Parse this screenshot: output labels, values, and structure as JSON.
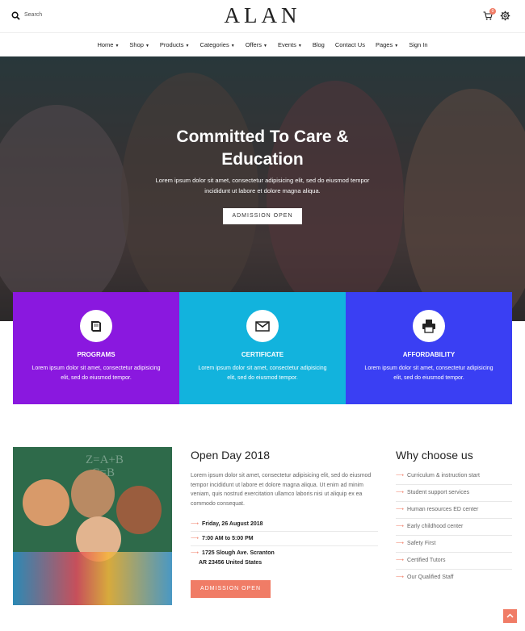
{
  "header": {
    "search_label": "Search",
    "logo": "ALAN",
    "cart_count": "0"
  },
  "nav": {
    "items": [
      {
        "label": "Home",
        "caret": "▼"
      },
      {
        "label": "Shop",
        "caret": "▼"
      },
      {
        "label": "Products",
        "caret": "▼"
      },
      {
        "label": "Categories",
        "caret": "▼"
      },
      {
        "label": "Offers",
        "caret": "▼"
      },
      {
        "label": "Events",
        "caret": "▼"
      },
      {
        "label": "Blog",
        "caret": ""
      },
      {
        "label": "Contact Us",
        "caret": ""
      },
      {
        "label": "Pages",
        "caret": "▼"
      },
      {
        "label": "Sign In",
        "caret": ""
      }
    ]
  },
  "hero": {
    "title_line1": "Committed To Care &",
    "title_line2": "Education",
    "text_line1": "Lorem ipsum dolor sit amet, consectetur adipisicing elit, sed do eiusmod tempor",
    "text_line2": "incididunt ut labore et dolore magna aliqua.",
    "button": "ADMISSION OPEN"
  },
  "features": [
    {
      "title": "PROGRAMS",
      "text": "Lorem ipsum dolor sit amet, consectetur adipisicing elit, sed do eiusmod tempor.",
      "color": "#8a18df",
      "icon": "book-icon"
    },
    {
      "title": "CERTIFICATE",
      "text": "Lorem ipsum dolor sit amet, consectetur adipisicing elit, sed do eiusmod tempor.",
      "color": "#12b3dd",
      "icon": "envelope-icon"
    },
    {
      "title": "AFFORDABILITY",
      "text": "Lorem ipsum dolor sit amet, consectetur adipisicing elit, sed do eiusmod tempor.",
      "color": "#3a3ff3",
      "icon": "printer-icon"
    }
  ],
  "open_day": {
    "title": "Open Day 2018",
    "text": "Lorem ipsum dolor sit amet, consectetur adipisicing elit, sed do eiusmod tempor incididunt ut labore et dolore magna aliqua. Ut enim ad minim veniam, quis nostrud exercitation ullamco laboris nisi ut aliquip ex ea commodo consequat.",
    "date": "Friday, 26 August 2018",
    "time": "7:00 AM to 5:00 PM",
    "address_line1": "1725 Slough Ave. Scranton",
    "address_line2": "AR 23456 United States",
    "button": "ADMISSION OPEN"
  },
  "why": {
    "title": "Why choose us",
    "items": [
      "Curriculum & instruction start",
      "Student support services",
      "Human resources ED center",
      "Early childhood center",
      "Safety First",
      "Certified Tutors",
      "Our Qualified Staff"
    ]
  },
  "colors": {
    "accent": "#f07c66"
  }
}
